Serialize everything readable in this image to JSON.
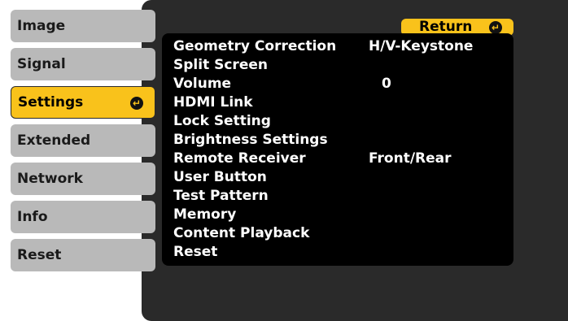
{
  "tabs": [
    {
      "label": "Image"
    },
    {
      "label": "Signal"
    },
    {
      "label": "Settings"
    },
    {
      "label": "Extended"
    },
    {
      "label": "Network"
    },
    {
      "label": "Info"
    },
    {
      "label": "Reset"
    }
  ],
  "return_button": {
    "label": "Return"
  },
  "menu": [
    {
      "label": "Geometry Correction",
      "value": "H/V-Keystone"
    },
    {
      "label": "Split Screen",
      "value": ""
    },
    {
      "label": "Volume",
      "value": "0"
    },
    {
      "label": "HDMI Link",
      "value": ""
    },
    {
      "label": "Lock Setting",
      "value": ""
    },
    {
      "label": "Brightness Settings",
      "value": ""
    },
    {
      "label": "Remote Receiver",
      "value": "Front/Rear"
    },
    {
      "label": "User Button",
      "value": ""
    },
    {
      "label": "Test Pattern",
      "value": ""
    },
    {
      "label": "Memory",
      "value": ""
    },
    {
      "label": "Content Playback",
      "value": ""
    },
    {
      "label": "Reset",
      "value": ""
    }
  ],
  "colors": {
    "accent": "#f9c21b",
    "panel": "#2a2a2a",
    "tab": "#b9b9b9",
    "menu_bg": "#000000"
  },
  "icons": {
    "enter": "enter-arrow-icon"
  }
}
